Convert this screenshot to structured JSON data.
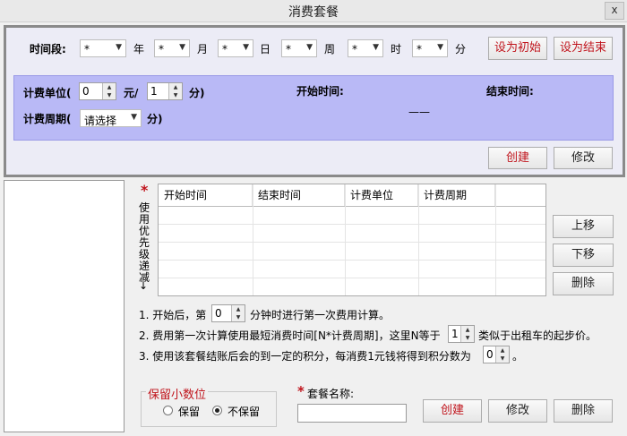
{
  "window": {
    "title": "消费套餐",
    "close_label": "x"
  },
  "period": {
    "label": "时间段:",
    "year_value": "*",
    "year_unit": "年",
    "month_value": "*",
    "month_unit": "月",
    "day_value": "*",
    "day_unit": "日",
    "week_value": "*",
    "week_unit": "周",
    "hour_value": "*",
    "hour_unit": "时",
    "minute_value": "*",
    "minute_unit": "分",
    "set_start_label": "设为初始",
    "set_end_label": "设为结束"
  },
  "billing": {
    "unit_label": "计费单位(",
    "unit_value": "0",
    "unit_mid": "元/",
    "unit_minutes_value": "1",
    "unit_suffix": "分)",
    "cycle_label": "计费周期(",
    "cycle_select": "请选择",
    "cycle_suffix": "分)",
    "start_time_label": "开始时间:",
    "end_time_label": "结束时间:",
    "dash": "——"
  },
  "frame_buttons": {
    "create_label": "创建",
    "modify_label": "修改"
  },
  "priority": {
    "star": "*",
    "text": "使用优先级递减",
    "arrow": "↓"
  },
  "grid": {
    "headers": [
      "开始时间",
      "结束时间",
      "计费单位",
      "计费周期"
    ]
  },
  "side_buttons": {
    "up_label": "上移",
    "down_label": "下移",
    "delete_label": "删除"
  },
  "notes": {
    "n1_pre": "1. 开始后，第",
    "n1_value": "0",
    "n1_post": "分钟时进行第一次费用计算。",
    "n2_pre": "2. 费用第一次计算使用最短消费时间[N*计费周期]，这里N等于",
    "n2_value": "1",
    "n2_post": "类似于出租车的起步价。",
    "n3_pre": "3. 使用该套餐结账后会的到一定的积分，每消费1元钱将得到积分数为",
    "n3_value": "0",
    "n3_post": "。"
  },
  "decimal": {
    "legend": "保留小数位",
    "keep_label": "保留",
    "nokeep_label": "不保留",
    "selected": "不保留"
  },
  "package": {
    "star": "*",
    "name_label": "套餐名称:",
    "name_value": ""
  },
  "bottom_buttons": {
    "create_label": "创建",
    "modify_label": "修改",
    "delete_label": "删除"
  },
  "colors": {
    "panel": "#b9b9f6",
    "accent_red": "#c0141c",
    "frame": "#8a8a8a"
  }
}
